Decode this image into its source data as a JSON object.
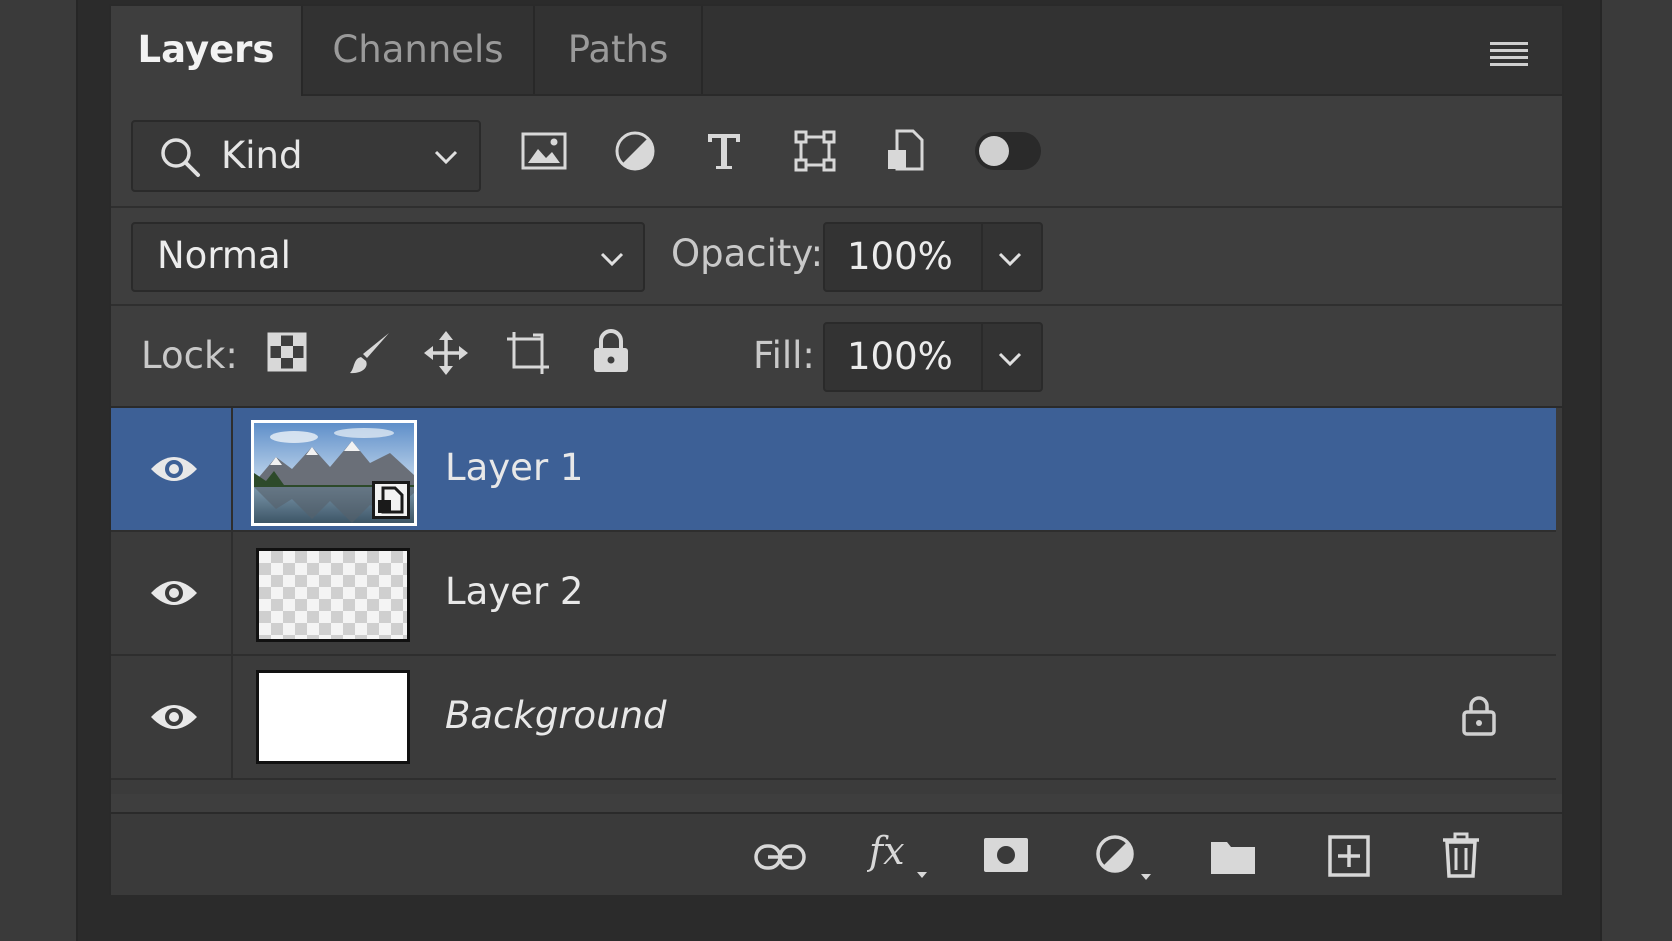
{
  "tabs": [
    {
      "label": "Layers",
      "active": true
    },
    {
      "label": "Channels",
      "active": false
    },
    {
      "label": "Paths",
      "active": false
    }
  ],
  "filter": {
    "kind_label": "Kind",
    "icons": [
      "image-filter-icon",
      "adjustment-filter-icon",
      "type-filter-icon",
      "shape-filter-icon",
      "smart-object-filter-icon",
      "filter-toggle-switch"
    ]
  },
  "blend": {
    "mode": "Normal",
    "opacity_label": "Opacity:",
    "opacity_value": "100%"
  },
  "lock": {
    "label": "Lock:",
    "fill_label": "Fill:",
    "fill_value": "100%",
    "icons": [
      "lock-transparent-pixels-icon",
      "lock-image-pixels-icon",
      "lock-position-icon",
      "lock-artboard-icon",
      "lock-all-icon"
    ]
  },
  "layers": [
    {
      "name": "Layer 1",
      "selected": true,
      "visible": true,
      "thumb": "mountain-photo"
    },
    {
      "name": "Layer 2",
      "selected": false,
      "visible": true,
      "thumb": "transparent"
    },
    {
      "name": "Background",
      "selected": false,
      "visible": true,
      "thumb": "white",
      "locked": true
    }
  ],
  "footer_icons": [
    "link-layers-icon",
    "fx-icon",
    "add-mask-icon",
    "adjustment-layer-icon",
    "new-group-icon",
    "new-layer-icon",
    "delete-layer-icon"
  ],
  "colors": {
    "panel": "#3e3e3e",
    "selected_row": "#3d6096",
    "tabbar": "#323232"
  }
}
